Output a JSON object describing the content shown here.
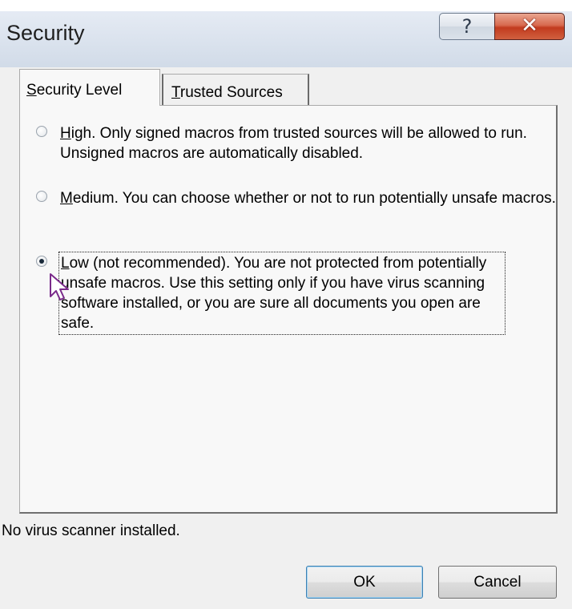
{
  "window": {
    "title": "Security",
    "help_glyph": "?",
    "close_glyph": "✕"
  },
  "tabs": [
    {
      "label_prefix": "",
      "label_underlined": "S",
      "label_rest": "ecurity Level",
      "selected": true
    },
    {
      "label_prefix": "",
      "label_underlined": "T",
      "label_rest": "rusted Sources",
      "selected": false
    }
  ],
  "options": [
    {
      "id": "high",
      "underlined": "H",
      "text": "igh. Only signed macros from trusted sources will be allowed to run. Unsigned macros are automatically disabled.",
      "selected": false
    },
    {
      "id": "medium",
      "underlined": "M",
      "text": "edium. You can choose whether or not to run potentially unsafe macros.",
      "selected": false
    },
    {
      "id": "low",
      "underlined": "L",
      "text": "ow (not recommended). You are not protected from potentially unsafe macros. Use this setting only if you have virus scanning software installed, or you are sure all documents you open are safe.",
      "selected": true
    }
  ],
  "status": {
    "text": "No virus scanner installed."
  },
  "buttons": {
    "ok": "OK",
    "cancel": "Cancel"
  },
  "colors": {
    "close_button": "#c23b1e",
    "dialog_background": "#f0f0f0",
    "panel_background": "#f8f8f8"
  }
}
